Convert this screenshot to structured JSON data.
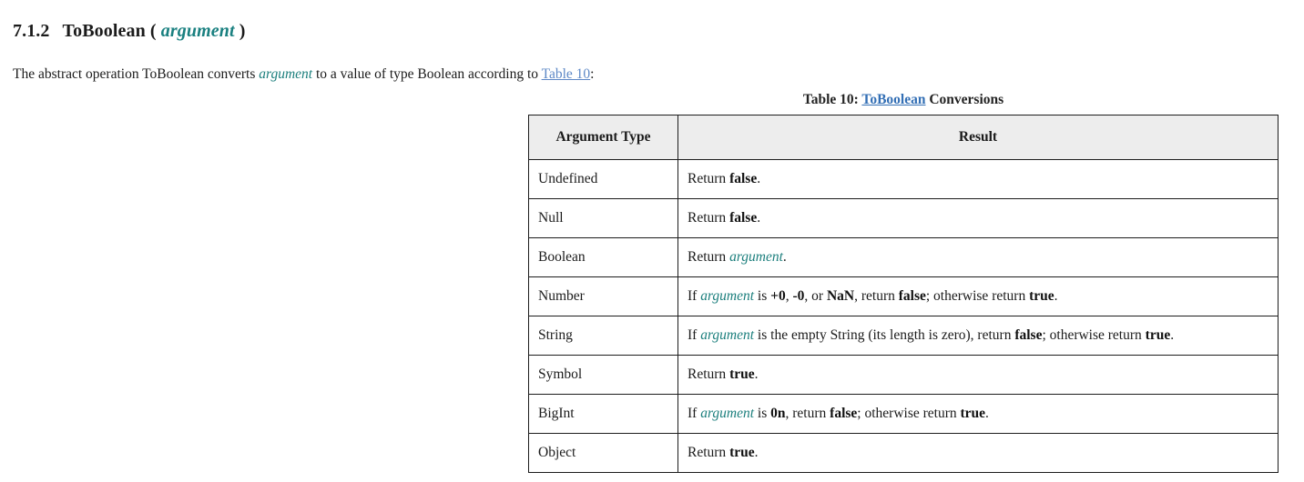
{
  "heading": {
    "number": "7.1.2",
    "name": "ToBoolean",
    "open_paren": "(",
    "parameter": "argument",
    "close_paren": ")"
  },
  "intro": {
    "before_op": "The abstract operation ",
    "operation": "ToBoolean",
    "after_op": " converts ",
    "parameter": "argument",
    "middle": " to a value of type Boolean according to ",
    "table_ref": "Table 10",
    "suffix": ":"
  },
  "table": {
    "caption": {
      "prefix": "Table 10: ",
      "link": "ToBoolean",
      "suffix": " Conversions"
    },
    "columns": [
      {
        "label": "Argument Type"
      },
      {
        "label": "Result"
      }
    ],
    "rows": [
      {
        "type": "Undefined",
        "result": {
          "parts": [
            {
              "text": "Return ",
              "style": "plain"
            },
            {
              "text": "false",
              "style": "bold"
            },
            {
              "text": ".",
              "style": "plain"
            }
          ]
        }
      },
      {
        "type": "Null",
        "result": {
          "parts": [
            {
              "text": "Return ",
              "style": "plain"
            },
            {
              "text": "false",
              "style": "bold"
            },
            {
              "text": ".",
              "style": "plain"
            }
          ]
        }
      },
      {
        "type": "Boolean",
        "result": {
          "parts": [
            {
              "text": "Return ",
              "style": "plain"
            },
            {
              "text": "argument",
              "style": "var"
            },
            {
              "text": ".",
              "style": "plain"
            }
          ]
        }
      },
      {
        "type": "Number",
        "result": {
          "parts": [
            {
              "text": "If ",
              "style": "plain"
            },
            {
              "text": "argument",
              "style": "var"
            },
            {
              "text": " is ",
              "style": "plain"
            },
            {
              "text": "+0",
              "style": "bold"
            },
            {
              "text": ", ",
              "style": "plain"
            },
            {
              "text": "-0",
              "style": "bold"
            },
            {
              "text": ", or ",
              "style": "plain"
            },
            {
              "text": "NaN",
              "style": "bold"
            },
            {
              "text": ", return ",
              "style": "plain"
            },
            {
              "text": "false",
              "style": "bold"
            },
            {
              "text": "; otherwise return ",
              "style": "plain"
            },
            {
              "text": "true",
              "style": "bold"
            },
            {
              "text": ".",
              "style": "plain"
            }
          ]
        }
      },
      {
        "type": "String",
        "result": {
          "parts": [
            {
              "text": "If ",
              "style": "plain"
            },
            {
              "text": "argument",
              "style": "var"
            },
            {
              "text": " is the empty String (its length is zero), return ",
              "style": "plain"
            },
            {
              "text": "false",
              "style": "bold"
            },
            {
              "text": "; otherwise return ",
              "style": "plain"
            },
            {
              "text": "true",
              "style": "bold"
            },
            {
              "text": ".",
              "style": "plain"
            }
          ]
        }
      },
      {
        "type": "Symbol",
        "result": {
          "parts": [
            {
              "text": "Return ",
              "style": "plain"
            },
            {
              "text": "true",
              "style": "bold"
            },
            {
              "text": ".",
              "style": "plain"
            }
          ]
        }
      },
      {
        "type": "BigInt",
        "result": {
          "parts": [
            {
              "text": "If ",
              "style": "plain"
            },
            {
              "text": "argument",
              "style": "var"
            },
            {
              "text": " is ",
              "style": "plain"
            },
            {
              "text": "0n",
              "style": "bold"
            },
            {
              "text": ", return ",
              "style": "plain"
            },
            {
              "text": "false",
              "style": "bold"
            },
            {
              "text": "; otherwise return ",
              "style": "plain"
            },
            {
              "text": "true",
              "style": "bold"
            },
            {
              "text": ".",
              "style": "plain"
            }
          ]
        }
      },
      {
        "type": "Object",
        "result": {
          "parts": [
            {
              "text": "Return ",
              "style": "plain"
            },
            {
              "text": "true",
              "style": "bold"
            },
            {
              "text": ".",
              "style": "plain"
            }
          ]
        }
      }
    ]
  },
  "colors": {
    "variable_teal": "#1c7f7d",
    "xref_blue": "#5d88c6",
    "caption_link_blue": "#336fb5",
    "header_background": "#ededed",
    "border": "#1c1c1c",
    "text": "#1b1b1b"
  }
}
